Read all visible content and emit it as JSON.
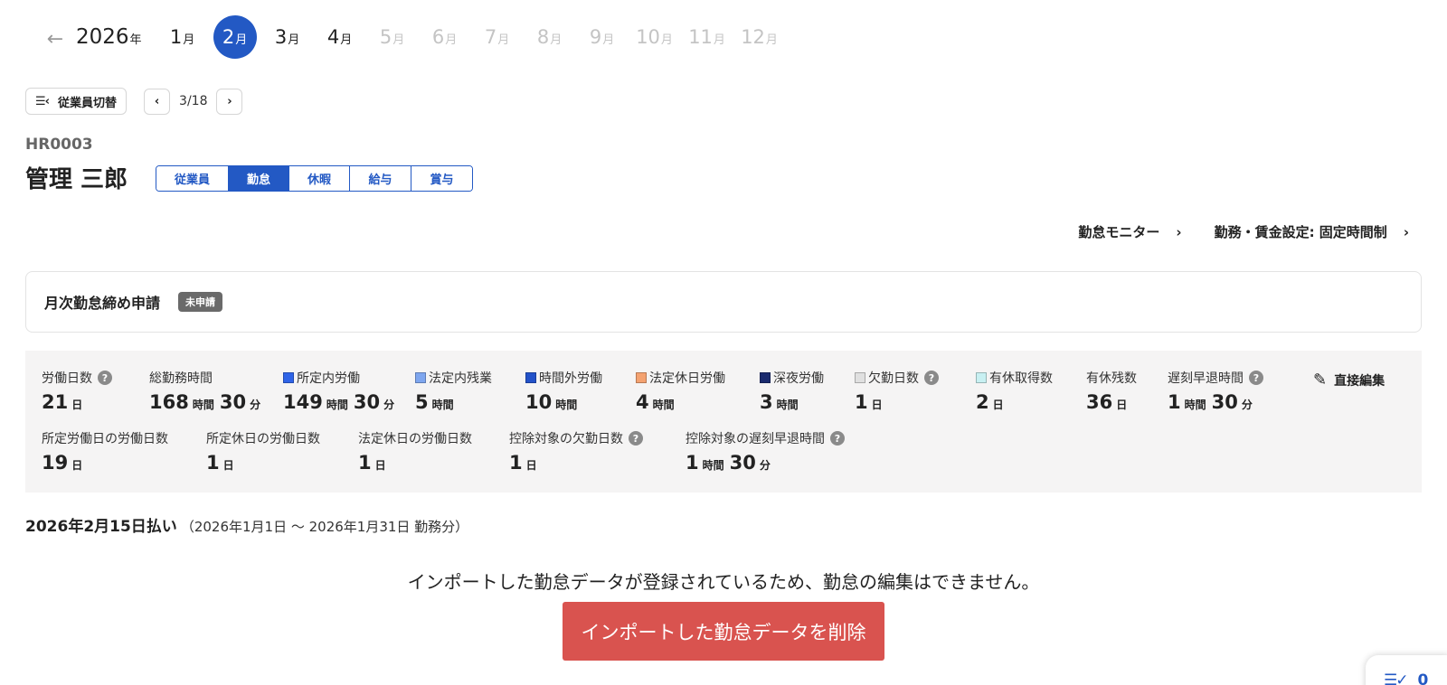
{
  "calendar": {
    "back_icon": "arrow-left-icon",
    "year": "2026",
    "year_suffix": "年",
    "month_suffix": "月",
    "months": [
      {
        "num": "1",
        "state": "enabled"
      },
      {
        "num": "2",
        "state": "active"
      },
      {
        "num": "3",
        "state": "enabled"
      },
      {
        "num": "4",
        "state": "enabled"
      },
      {
        "num": "5",
        "state": "disabled"
      },
      {
        "num": "6",
        "state": "disabled"
      },
      {
        "num": "7",
        "state": "disabled"
      },
      {
        "num": "8",
        "state": "disabled"
      },
      {
        "num": "9",
        "state": "disabled"
      },
      {
        "num": "10",
        "state": "disabled"
      },
      {
        "num": "11",
        "state": "disabled"
      },
      {
        "num": "12",
        "state": "disabled"
      }
    ]
  },
  "employee_switch": {
    "label": "従業員切替",
    "icon": "list-collapse-icon",
    "glyph": "☰‹",
    "pager": "3/18",
    "prev": "‹",
    "next": "›"
  },
  "employee": {
    "code": "HR0003",
    "name": "管理 三郎"
  },
  "tabs": [
    {
      "label": "従業員",
      "active": false
    },
    {
      "label": "勤怠",
      "active": true
    },
    {
      "label": "休暇",
      "active": false
    },
    {
      "label": "給与",
      "active": false
    },
    {
      "label": "賞与",
      "active": false
    }
  ],
  "links": {
    "monitor": "勤怠モニター",
    "settings": "勤務・賃金設定: 固定時間制",
    "chevron": "›"
  },
  "monthly_close": {
    "title": "月次勤怠締め申請",
    "status": "未申請"
  },
  "summary": {
    "edit_label": "直接編集",
    "edit_icon": "pencil-icon",
    "help_glyph": "?",
    "row1": [
      {
        "label": "労働日数",
        "help": true,
        "parts": [
          {
            "n": "21",
            "u": "日"
          }
        ]
      },
      {
        "label": "総勤務時間",
        "parts": [
          {
            "n": "168",
            "u": "時間"
          },
          {
            "n": "30",
            "u": "分"
          }
        ]
      },
      {
        "label": "所定内労働",
        "swatch": "#2f64e8",
        "parts": [
          {
            "n": "149",
            "u": "時間"
          },
          {
            "n": "30",
            "u": "分"
          }
        ]
      },
      {
        "label": "法定内残業",
        "swatch": "#7ea6ef",
        "parts": [
          {
            "n": "5",
            "u": "時間"
          }
        ]
      },
      {
        "label": "時間外労働",
        "swatch": "#2352c9",
        "parts": [
          {
            "n": "10",
            "u": "時間"
          }
        ]
      },
      {
        "label": "法定休日労働",
        "swatch": "#f4a270",
        "parts": [
          {
            "n": "4",
            "u": "時間"
          }
        ]
      },
      {
        "label": "深夜労働",
        "swatch": "#1a2a6e",
        "parts": [
          {
            "n": "3",
            "u": "時間"
          }
        ]
      },
      {
        "label": "欠勤日数",
        "swatch": "#e0e0e0",
        "help": true,
        "parts": [
          {
            "n": "1",
            "u": "日"
          }
        ]
      },
      {
        "label": "有休取得数",
        "swatch": "#c8f0f2",
        "parts": [
          {
            "n": "2",
            "u": "日"
          }
        ]
      },
      {
        "label": "有休残数",
        "parts": [
          {
            "n": "36",
            "u": "日"
          }
        ]
      },
      {
        "label": "遅刻早退時間",
        "help": true,
        "parts": [
          {
            "n": "1",
            "u": "時間"
          },
          {
            "n": "30",
            "u": "分"
          }
        ]
      }
    ],
    "row2": [
      {
        "label": "所定労働日の労働日数",
        "parts": [
          {
            "n": "19",
            "u": "日"
          }
        ]
      },
      {
        "label": "所定休日の労働日数",
        "parts": [
          {
            "n": "1",
            "u": "日"
          }
        ]
      },
      {
        "label": "法定休日の労働日数",
        "parts": [
          {
            "n": "1",
            "u": "日"
          }
        ]
      },
      {
        "label": "控除対象の欠勤日数",
        "help": true,
        "parts": [
          {
            "n": "1",
            "u": "日"
          }
        ]
      },
      {
        "label": "控除対象の遅刻早退時間",
        "help": true,
        "parts": [
          {
            "n": "1",
            "u": "時間"
          },
          {
            "n": "30",
            "u": "分"
          }
        ]
      }
    ]
  },
  "payment": {
    "date": "2026年2月15日払い",
    "period": "（2026年1月1日 〜 2026年1月31日 勤務分）"
  },
  "notice": "インポートした勤怠データが登録されているため、勤怠の編集はできません。",
  "delete_button": "インポートした勤怠データを削除",
  "widget": {
    "icon": "list-check-icon",
    "glyph": "☰✓",
    "count": "0"
  },
  "colors": {
    "accent": "#2359c4",
    "danger": "#d9534f"
  }
}
